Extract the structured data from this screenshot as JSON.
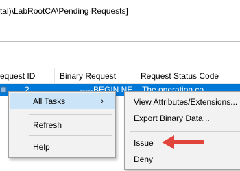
{
  "title": {
    "path_text": "tal)\\LabRootCA\\Pending Requests]"
  },
  "table": {
    "columns": [
      "equest ID",
      "Binary Request",
      "Request Status Code"
    ],
    "selected_row": {
      "request_id": "2",
      "binary_request": "-----BEGIN NE",
      "status_code": "The operation co..."
    }
  },
  "context_menu": {
    "items": [
      {
        "label": "All Tasks",
        "submenu_arrow": "›"
      },
      {
        "label": "Refresh"
      },
      {
        "label": "Help"
      }
    ]
  },
  "submenu": {
    "items": [
      {
        "label": "View Attributes/Extensions..."
      },
      {
        "label": "Export Binary Data..."
      },
      {
        "label": "Issue"
      },
      {
        "label": "Deny"
      }
    ]
  },
  "colors": {
    "selection": "#0078d7",
    "menu_bg": "#f2f2f2",
    "menu_highlight": "#cce4f7",
    "annotation_arrow": "#e0443a"
  }
}
